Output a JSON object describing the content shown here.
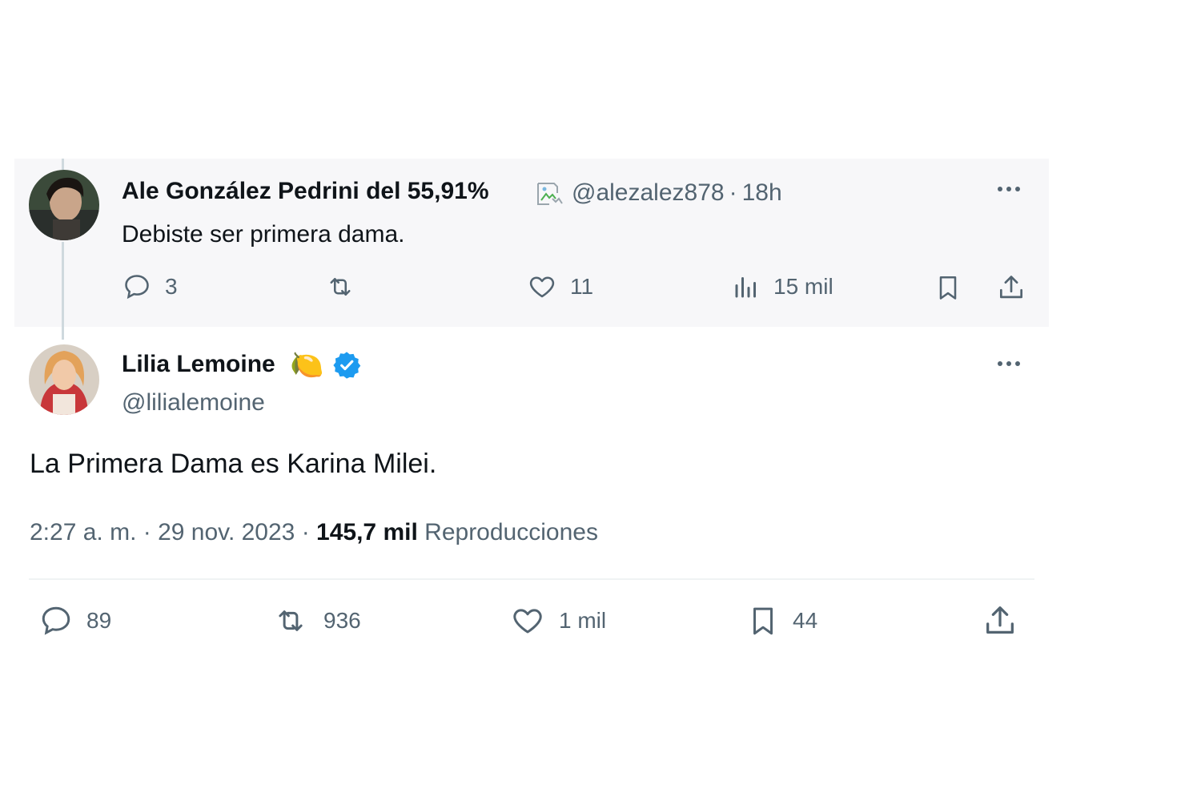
{
  "parent_tweet": {
    "author_name": "Ale González Pedrini del 55,91%",
    "handle": "@alezalez878",
    "separator": "·",
    "time": "18h",
    "text": "Debiste ser primera dama.",
    "actions": {
      "replies": "3",
      "retweets": "",
      "likes": "11",
      "views": "15 mil"
    }
  },
  "main_tweet": {
    "author_name": "Lilia Lemoine",
    "emoji": "🍋",
    "handle": "@lilialemoine",
    "text": "La Primera Dama es Karina Milei.",
    "time": "2:27 a. m.",
    "sep1": "·",
    "date": "29 nov. 2023",
    "sep2": "·",
    "views_count": "145,7 mil",
    "views_label": "Reproducciones",
    "actions": {
      "replies": "89",
      "retweets": "936",
      "likes": "1 mil",
      "bookmarks": "44"
    }
  },
  "colors": {
    "text": "#0f1419",
    "muted": "#536471",
    "verified": "#1d9bf0",
    "parent_bg": "#f7f7f9"
  }
}
